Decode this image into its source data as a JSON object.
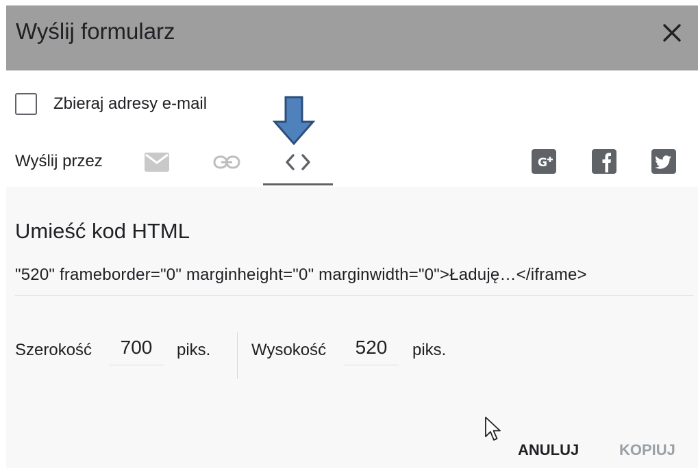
{
  "dialog": {
    "title": "Wyślij formularz"
  },
  "collect_emails": {
    "label": "Zbieraj adresy e-mail",
    "checked": false
  },
  "send_via": {
    "label": "Wyślij przez",
    "tabs": [
      "email-icon",
      "link-icon",
      "embed-code-icon"
    ],
    "active_tab": "embed-code-icon",
    "social": [
      "google-plus-icon",
      "facebook-icon",
      "twitter-icon"
    ]
  },
  "embed": {
    "title": "Umieść kod HTML",
    "code": "\"520\" frameborder=\"0\" marginheight=\"0\" marginwidth=\"0\">Ładuję…</iframe>",
    "width_label": "Szerokość",
    "width_value": "700",
    "width_unit": "piks.",
    "height_label": "Wysokość",
    "height_value": "520",
    "height_unit": "piks."
  },
  "buttons": {
    "cancel": "ANULUJ",
    "copy": "KOPIUJ"
  },
  "colors": {
    "header_bg": "#9e9e9e",
    "annotation_arrow": "#4f81bd"
  }
}
